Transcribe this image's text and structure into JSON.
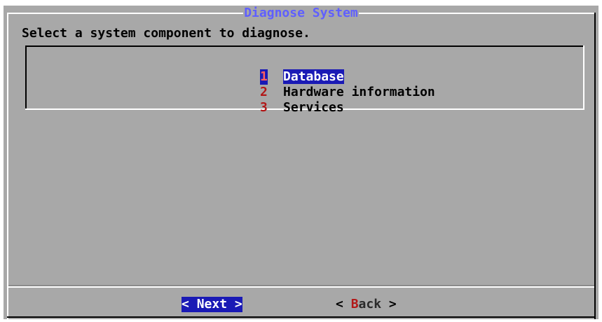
{
  "dialog": {
    "title": "Diagnose System",
    "prompt": "Select a system component to diagnose."
  },
  "menu": {
    "items": [
      {
        "number": "1",
        "label": "Database",
        "selected": true
      },
      {
        "number": "2",
        "label": "Hardware information",
        "selected": false
      },
      {
        "number": "3",
        "label": "Services",
        "selected": false
      }
    ]
  },
  "buttons": {
    "next": {
      "left": "< ",
      "label": "Next",
      "right": " >",
      "selected": true
    },
    "back": {
      "left": "< ",
      "hotkey": "B",
      "rest": "ack",
      "right": " >",
      "selected": false
    }
  },
  "colors": {
    "dialog_bg": "#a8a8a8",
    "title": "#5f5fff",
    "selection_bg": "#1a1ab5",
    "hotkey": "#b21818"
  }
}
